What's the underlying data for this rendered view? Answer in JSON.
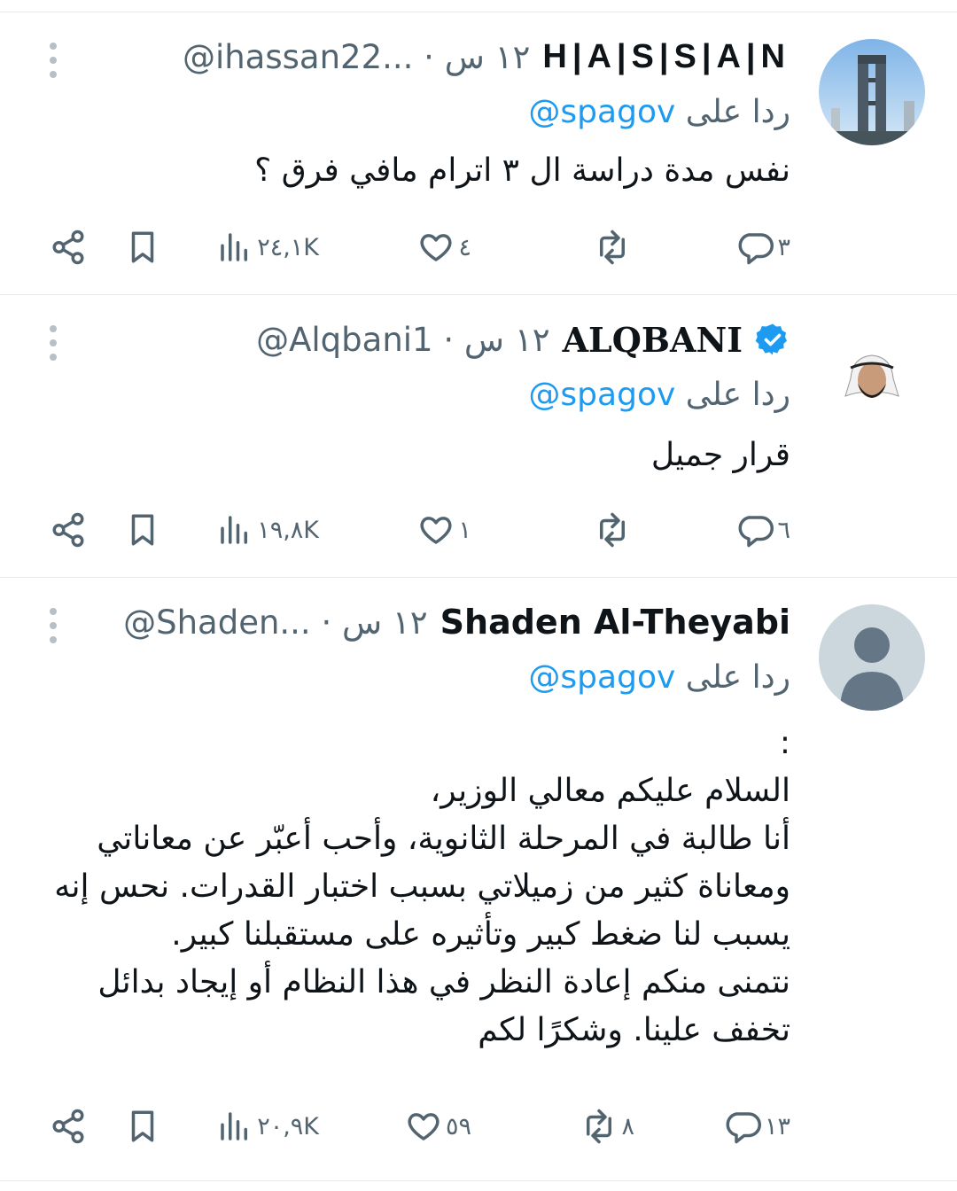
{
  "tweets": [
    {
      "author": "H|A|S|S|A|N",
      "meta": "@ihassan22... · ١٢ س",
      "reply_prefix": "ردا على",
      "reply_handle": "@spagov",
      "text": "نفس مدة دراسة ال ٣  اترام مافي فرق ؟",
      "replies": "٣",
      "retweets": "",
      "likes": "٤",
      "views": "٢٤,١K"
    },
    {
      "author": "ALQBANI",
      "meta": "@Alqbani1 · ١٢ س",
      "reply_prefix": "ردا على",
      "reply_handle": "@spagov",
      "text": "قرار جميل",
      "replies": "٦",
      "retweets": "",
      "likes": "١",
      "views": "١٩,٨K"
    },
    {
      "author": "Shaden Al-Theyabi",
      "meta": "@Shaden... · ١٢ س",
      "reply_prefix": "ردا على",
      "reply_handle": "@spagov",
      "text": ":\nالسلام عليكم معالي الوزير،\nأنا طالبة في المرحلة الثانوية، وأحب أعبّر عن معاناتي ومعاناة كثير من زميلاتي بسبب اختبار القدرات. نحس إنه يسبب لنا ضغط كبير وتأثيره على مستقبلنا كبير.\nنتمنى منكم إعادة النظر في هذا النظام أو إيجاد بدائل تخفف علينا. وشكرًا لكم",
      "replies": "١٣",
      "retweets": "٨",
      "likes": "٥٩",
      "views": "٢٠,٩K"
    }
  ],
  "icons": {
    "more": "more-vertical-icon",
    "verified": "verified-badge-icon",
    "reply": "reply-bubble-icon",
    "retweet": "retweet-icon",
    "like": "heart-icon",
    "views": "views-bar-chart-icon",
    "bookmark": "bookmark-icon",
    "share": "share-icon"
  },
  "colors": {
    "text": "#0f1419",
    "muted": "#536471",
    "link": "#1d9bf0",
    "verified": "#1d9bf0",
    "divider": "#e6e9eb"
  }
}
